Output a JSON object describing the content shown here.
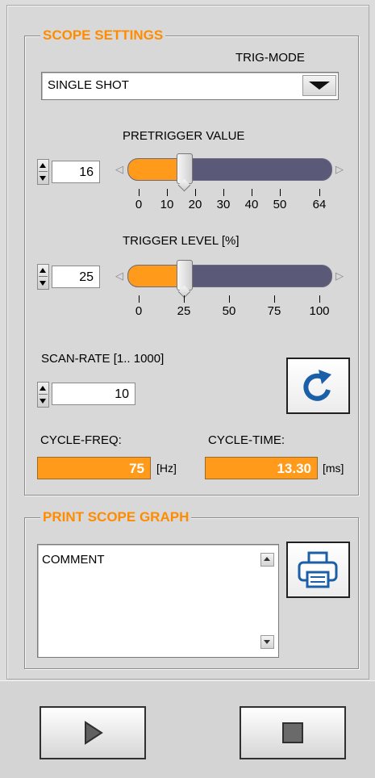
{
  "scope_settings": {
    "title": "SCOPE SETTINGS",
    "trig_mode_label": "TRIG-MODE",
    "trig_mode_value": "SINGLE SHOT",
    "pretrigger": {
      "label": "PRETRIGGER VALUE",
      "value": "16",
      "min": 0,
      "max": 64,
      "current": 16,
      "ticks": [
        "0",
        "10",
        "20",
        "30",
        "40",
        "50",
        "64"
      ]
    },
    "trigger_level": {
      "label": "TRIGGER LEVEL [%]",
      "value": "25",
      "min": 0,
      "max": 100,
      "current": 25,
      "ticks": [
        "0",
        "25",
        "50",
        "75",
        "100"
      ]
    },
    "scan_rate": {
      "label": "SCAN-RATE [1.. 1000]",
      "value": "10"
    },
    "cycle_freq": {
      "label": "CYCLE-FREQ:",
      "value": "75",
      "unit": "[Hz]"
    },
    "cycle_time": {
      "label": "CYCLE-TIME:",
      "value": "13.30",
      "unit": "[ms]"
    }
  },
  "print_scope": {
    "title": "PRINT SCOPE GRAPH",
    "comment_value": "COMMENT"
  },
  "icons": {
    "refresh": "refresh-icon",
    "printer": "printer-icon",
    "play": "play-icon",
    "stop": "stop-icon"
  },
  "colors": {
    "accent": "#ff8c00",
    "slider_fill": "#ff9a1a",
    "slider_track": "#5a5a78",
    "refresh_blue": "#1a5fa8"
  }
}
